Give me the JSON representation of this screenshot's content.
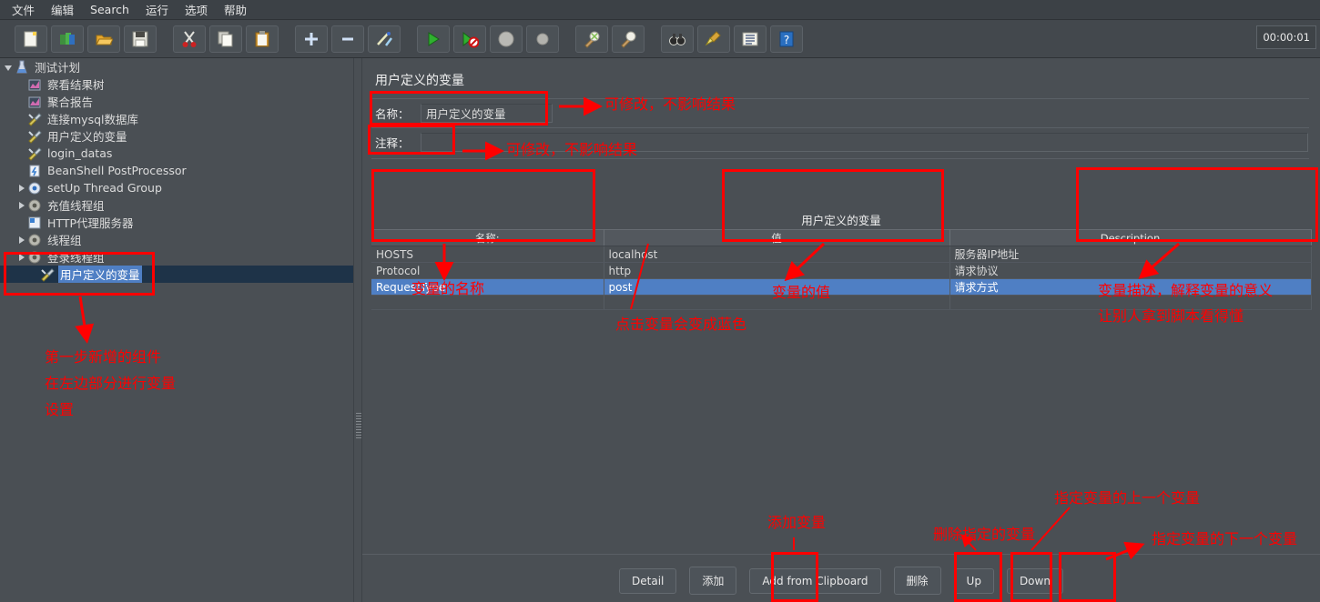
{
  "menu": {
    "items": [
      "文件",
      "编辑",
      "Search",
      "运行",
      "选项",
      "帮助"
    ]
  },
  "toolbar": {
    "timer": "00:00:01",
    "buttons": [
      {
        "name": "new-icon",
        "glyph": "new"
      },
      {
        "name": "templates-icon",
        "glyph": "templates"
      },
      {
        "name": "open-icon",
        "glyph": "open"
      },
      {
        "name": "save-icon",
        "glyph": "save"
      },
      {
        "name": "cut-icon",
        "glyph": "cut"
      },
      {
        "name": "copy-icon",
        "glyph": "copy"
      },
      {
        "name": "paste-icon",
        "glyph": "paste"
      },
      {
        "name": "expand-all-icon",
        "glyph": "plus"
      },
      {
        "name": "collapse-all-icon",
        "glyph": "minus"
      },
      {
        "name": "toggle-icon",
        "glyph": "wand"
      },
      {
        "name": "start-icon",
        "glyph": "play"
      },
      {
        "name": "start-no-pauses-icon",
        "glyph": "play-no-pause"
      },
      {
        "name": "stop-icon",
        "glyph": "stop"
      },
      {
        "name": "shutdown-icon",
        "glyph": "shutdown"
      },
      {
        "name": "clear-icon",
        "glyph": "clear"
      },
      {
        "name": "clear-all-icon",
        "glyph": "clear-all"
      },
      {
        "name": "search-icon",
        "glyph": "binoculars"
      },
      {
        "name": "reset-search-icon",
        "glyph": "broom"
      },
      {
        "name": "function-helper-icon",
        "glyph": "list"
      },
      {
        "name": "help-icon",
        "glyph": "help"
      }
    ]
  },
  "tree": {
    "items": [
      {
        "label": "测试计划",
        "depth": 0,
        "twisty": "down",
        "icon": "testplan",
        "selected": false
      },
      {
        "label": "察看结果树",
        "depth": 1,
        "twisty": "none",
        "icon": "listener",
        "selected": false
      },
      {
        "label": "聚合报告",
        "depth": 1,
        "twisty": "none",
        "icon": "listener",
        "selected": false
      },
      {
        "label": "连接mysql数据库",
        "depth": 1,
        "twisty": "none",
        "icon": "config",
        "selected": false
      },
      {
        "label": "用户定义的变量",
        "depth": 1,
        "twisty": "none",
        "icon": "config",
        "selected": false
      },
      {
        "label": "login_datas",
        "depth": 1,
        "twisty": "none",
        "icon": "config",
        "selected": false
      },
      {
        "label": "BeanShell PostProcessor",
        "depth": 1,
        "twisty": "none",
        "icon": "beanshell",
        "selected": false
      },
      {
        "label": "setUp Thread Group",
        "depth": 1,
        "twisty": "right",
        "icon": "gear-blue",
        "selected": false
      },
      {
        "label": "充值线程组",
        "depth": 1,
        "twisty": "right",
        "icon": "gear",
        "selected": false
      },
      {
        "label": "HTTP代理服务器",
        "depth": 1,
        "twisty": "none",
        "icon": "proxy",
        "selected": false
      },
      {
        "label": "线程组",
        "depth": 1,
        "twisty": "right",
        "icon": "gear",
        "selected": false
      },
      {
        "label": "登录线程组",
        "depth": 1,
        "twisty": "right",
        "icon": "gear",
        "selected": false
      },
      {
        "label": "用户定义的变量",
        "depth": 2,
        "twisty": "none",
        "icon": "config",
        "selected": true
      }
    ]
  },
  "pane": {
    "title": "用户定义的变量",
    "name_label": "名称：",
    "name_value": "用户定义的变量",
    "comment_label": "注释：",
    "comment_value": "",
    "table_caption": "用户定义的变量"
  },
  "table": {
    "headers": [
      "名称:",
      "值",
      "Description"
    ],
    "rows": [
      {
        "name": "HOSTS",
        "value": "localhost",
        "description": "服务器IP地址",
        "selected": false
      },
      {
        "name": "Protocol",
        "value": "http",
        "description": "请求协议",
        "selected": false
      },
      {
        "name": "RequestType",
        "value": "post",
        "description": "请求方式",
        "selected": true
      }
    ]
  },
  "buttons": {
    "detail": "Detail",
    "add": "添加",
    "add_from_clipboard": "Add from Clipboard",
    "delete": "删除",
    "up": "Up",
    "down": "Down"
  },
  "annotations": {
    "name_field": "可修改，不影响结果",
    "comment_field": "可修改，不影响结果",
    "col_name": "变量的名称",
    "col_click": "点击变量会变成蓝色",
    "col_value": "变量的值",
    "col_desc_line1": "变量描述，解释变量的意义",
    "col_desc_line2": "让别人拿到脚本看得懂",
    "tree_line1": "第一步新增的组件",
    "tree_line2": "在左边部分进行变量",
    "tree_line3": "设置",
    "btn_add": "添加变量",
    "btn_delete": "删除指定的变量",
    "btn_up": "指定变量的上一个变量",
    "btn_down": "指定变量的下一个变量"
  },
  "colors": {
    "annotation": "#ff0000",
    "selection_blue": "#4f7fc4",
    "tree_selection_bg": "#1e3348",
    "panel_bg": "#4a4f54"
  }
}
